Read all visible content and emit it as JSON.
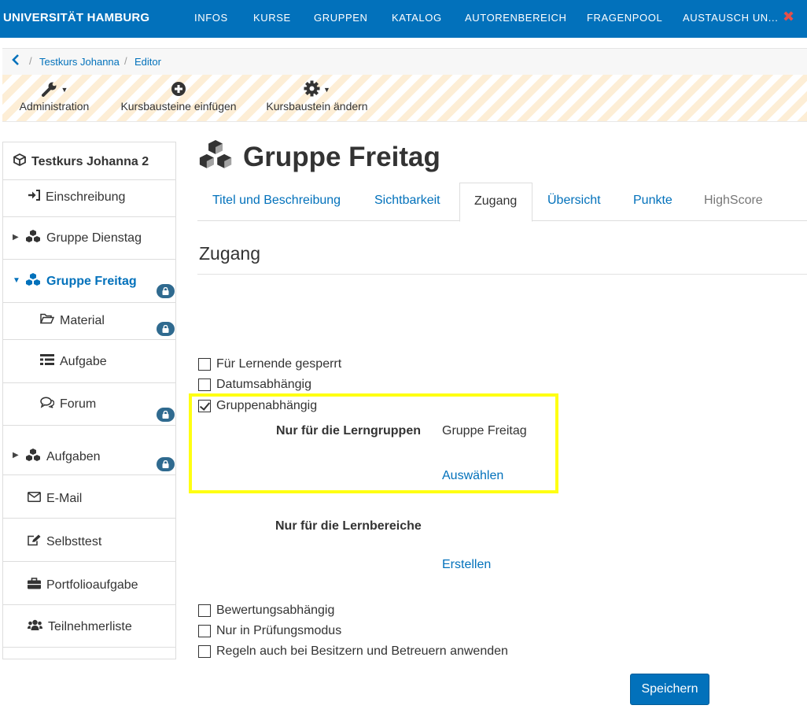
{
  "topnav": {
    "brand": "UNIVERSITÄT HAMBURG",
    "items": [
      "INFOS",
      "KURSE",
      "GRUPPEN",
      "KATALOG",
      "AUTORENBEREICH",
      "FRAGENPOOL",
      "AUSTAUSCH UN..."
    ],
    "close_icon": "close-icon",
    "accent": "#0271bb",
    "close_color": "#e5504a"
  },
  "breadcrumb": {
    "back_icon": "chevron-left-icon",
    "items": [
      "Testkurs Johanna",
      "Editor"
    ]
  },
  "toolbar": {
    "items": [
      {
        "label": "Administration",
        "icon": "wrench-icon"
      },
      {
        "label": "Kursbausteine einfügen",
        "icon": "plus-circle-icon"
      },
      {
        "label": "Kursbaustein ändern",
        "icon": "gear-icon"
      }
    ]
  },
  "sidebar": {
    "course_title": "Testkurs Johanna 2",
    "items": [
      {
        "label": "Einschreibung",
        "icon": "sign-in-icon"
      },
      {
        "label": "Gruppe Dienstag",
        "icon": "cubes-icon"
      },
      {
        "label": "Gruppe Freitag",
        "icon": "cubes-icon",
        "active": true
      },
      {
        "label": "Material",
        "icon": "folder-open-icon"
      },
      {
        "label": "Aufgabe",
        "icon": "list-icon"
      },
      {
        "label": "Forum",
        "icon": "comments-icon"
      },
      {
        "label": "Aufgaben",
        "icon": "cubes-icon"
      },
      {
        "label": "E-Mail",
        "icon": "envelope-icon"
      },
      {
        "label": "Selbsttest",
        "icon": "edit-icon"
      },
      {
        "label": "Portfolioaufgabe",
        "icon": "briefcase-icon"
      },
      {
        "label": "Teilnehmerliste",
        "icon": "users-icon"
      }
    ]
  },
  "main": {
    "title": "Gruppe Freitag",
    "tabs": [
      "Titel und Beschreibung",
      "Sichtbarkeit",
      "Zugang",
      "Übersicht",
      "Punkte",
      "HighScore"
    ],
    "active_tab": "Zugang",
    "section_title": "Zugang",
    "checkboxes": {
      "locked": {
        "label": "Für Lernende gesperrt",
        "checked": false
      },
      "date": {
        "label": "Datumsabhängig",
        "checked": false
      },
      "group": {
        "label": "Gruppenabhängig",
        "checked": true
      },
      "grading": {
        "label": "Bewertungsabhängig",
        "checked": false
      },
      "exam": {
        "label": "Nur in Prüfungsmodus",
        "checked": false
      },
      "owners": {
        "label": "Regeln auch bei Besitzern und Betreuern anwenden",
        "checked": false
      }
    },
    "groups_label": "Nur für die Lerngruppen",
    "groups_value": "Gruppe Freitag",
    "groups_link": "Auswählen",
    "areas_label": "Nur für die Lernbereiche",
    "areas_link": "Erstellen",
    "save_label": "Speichern",
    "highlight_color": "#ffff12"
  }
}
